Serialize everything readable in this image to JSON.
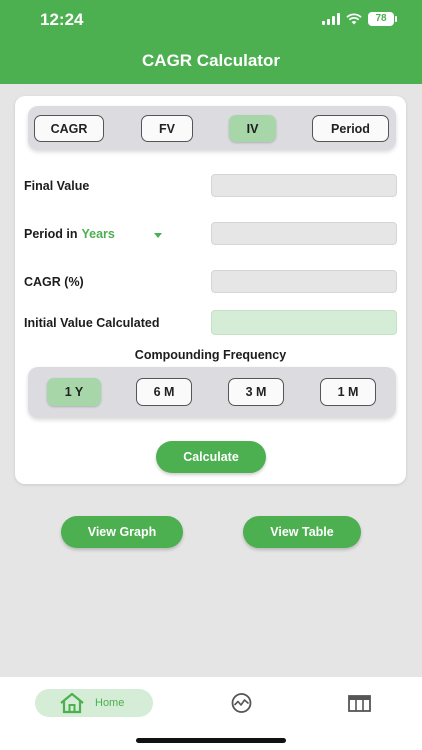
{
  "status": {
    "time": "12:24",
    "battery": "78"
  },
  "header": {
    "title": "CAGR Calculator"
  },
  "modes": [
    {
      "label": "CAGR",
      "active": false
    },
    {
      "label": "FV",
      "active": false
    },
    {
      "label": "IV",
      "active": true
    },
    {
      "label": "Period",
      "active": false
    }
  ],
  "form": {
    "final_value_label": "Final Value",
    "final_value": "",
    "period_label": "Period in",
    "period_unit": "Years",
    "period_value": "",
    "cagr_label": "CAGR (%)",
    "cagr_value": "",
    "initial_value_label": "Initial Value Calculated",
    "initial_value": ""
  },
  "frequency": {
    "title": "Compounding Frequency",
    "options": [
      {
        "label": "1 Y",
        "active": true
      },
      {
        "label": "6 M",
        "active": false
      },
      {
        "label": "3 M",
        "active": false
      },
      {
        "label": "1 M",
        "active": false
      }
    ]
  },
  "buttons": {
    "calculate": "Calculate",
    "view_graph": "View Graph",
    "view_table": "View Table"
  },
  "tabs": [
    {
      "label": "Home",
      "icon": "home-icon",
      "active": true
    },
    {
      "label": "",
      "icon": "graph-icon",
      "active": false
    },
    {
      "label": "",
      "icon": "table-icon",
      "active": false
    }
  ],
  "colors": {
    "accent": "#4caf50",
    "accent_light": "#a7d7a9",
    "background": "#e5e5e5"
  }
}
